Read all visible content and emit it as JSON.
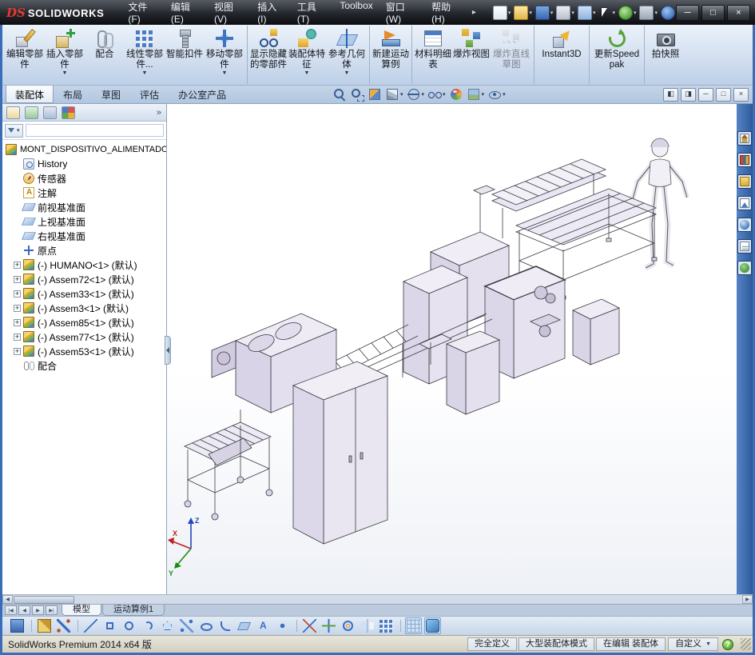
{
  "glyphs": {
    "down_arrow": "▼",
    "small_down": "▾",
    "plus": "+",
    "left_arrow": "◀",
    "right_arrow": "▶",
    "nav_first": "|◀",
    "nav_last": "▶|",
    "chevrons": "»",
    "minimize": "─",
    "maximize": "□",
    "close": "×",
    "pane_left": "◧",
    "pane_right": "◨",
    "menu_pin": "▸",
    "help": "?"
  },
  "titlebar": {
    "brand_mark": "DS",
    "brand_name": "SOLIDWORKS",
    "menus": [
      "文件(F)",
      "编辑(E)",
      "视图(V)",
      "插入(I)",
      "工具(T)",
      "Toolbox",
      "窗口(W)",
      "帮助(H)"
    ],
    "quick_icons": [
      {
        "name": "new-document-icon",
        "cls": "qi-new",
        "arrow": true
      },
      {
        "name": "open-icon",
        "cls": "qi-open",
        "arrow": true
      },
      {
        "name": "save-icon",
        "cls": "qi-save",
        "arrow": true
      },
      {
        "name": "print-icon",
        "cls": "qi-print",
        "arrow": true
      },
      {
        "name": "undo-icon",
        "cls": "qi-undo",
        "arrow": true
      },
      {
        "name": "select-icon",
        "cls": "qi-select",
        "arrow": true
      },
      {
        "name": "rebuild-icon",
        "cls": "qi-rebuild",
        "arrow": true
      },
      {
        "name": "options-icon",
        "cls": "qi-options",
        "arrow": true
      },
      {
        "name": "help-icon",
        "cls": "qi-help"
      }
    ]
  },
  "ribbon": {
    "buttons": [
      {
        "label": "编辑零部件",
        "icon": "ri-edit",
        "name": "edit-component-icon"
      },
      {
        "label": "插入零部件",
        "icon": "ri-insert",
        "name": "insert-components-icon",
        "arrow": true
      },
      {
        "label": "配合",
        "icon": "ri-mate",
        "name": "mate-icon"
      },
      {
        "label": "线性零部件...",
        "icon": "ri-pattern",
        "name": "linear-component-pattern-icon",
        "arrow": true
      },
      {
        "label": "智能扣件",
        "icon": "ri-fastener",
        "name": "smart-fasteners-icon"
      },
      {
        "label": "移动零部件",
        "icon": "ri-move",
        "name": "move-component-icon",
        "arrow": true
      },
      {
        "label": "显示隐藏的零部件",
        "icon": "ri-showhidden",
        "name": "show-hidden-components-icon",
        "mod": "grp"
      },
      {
        "label": "装配体特征",
        "icon": "ri-asmfeature",
        "name": "assembly-features-icon",
        "arrow": true
      },
      {
        "label": "参考几何体",
        "icon": "ri-refgeo",
        "name": "reference-geometry-icon",
        "arrow": true
      },
      {
        "label": "新建运动算例",
        "icon": "ri-motion",
        "name": "new-motion-study-icon",
        "mod": "grp"
      },
      {
        "label": "材料明细表",
        "icon": "ri-bom",
        "name": "bill-of-materials-icon",
        "mod": "grp"
      },
      {
        "label": "爆炸视图",
        "icon": "ri-explode",
        "name": "exploded-view-icon"
      },
      {
        "label": "爆炸直线草图",
        "icon": "ri-explodesketch",
        "name": "explode-line-sketch-icon",
        "mod": "disabled"
      },
      {
        "label": "Instant3D",
        "icon": "ri-instant3d",
        "name": "instant3d-icon",
        "mod": "grp wide"
      },
      {
        "label": "更新Speedpak",
        "icon": "ri-speedpak",
        "name": "update-speedpak-icon",
        "mod": "grp wide"
      },
      {
        "label": "拍快照",
        "icon": "ri-snapshot",
        "name": "take-snapshot-icon",
        "mod": "grp"
      }
    ]
  },
  "command_tabs": [
    {
      "label": "装配体",
      "state": "active"
    },
    {
      "label": "布局"
    },
    {
      "label": "草图"
    },
    {
      "label": "评估"
    },
    {
      "label": "办公室产品"
    }
  ],
  "view_toolbar": {
    "icons": [
      {
        "name": "zoom-to-fit-icon",
        "cls": "hi-zoomfit"
      },
      {
        "name": "zoom-to-area-icon",
        "cls": "hi-zoomarea"
      },
      {
        "name": "section-view-icon",
        "cls": "hi-section"
      },
      {
        "name": "view-orientation-icon",
        "cls": "hi-orient",
        "arrow": true
      },
      {
        "name": "display-style-icon",
        "cls": "hi-display",
        "arrow": true
      },
      {
        "name": "hide-show-items-icon",
        "cls": "hi-hideshow",
        "arrow": true
      },
      {
        "name": "edit-appearance-icon",
        "cls": "hi-appearance"
      },
      {
        "name": "apply-scene-icon",
        "cls": "hi-scene",
        "arrow": true
      },
      {
        "name": "view-settings-icon",
        "cls": "hi-viewsettings",
        "arrow": true
      }
    ]
  },
  "panel_tabs": [
    {
      "name": "featuremanager-tab-icon",
      "cls": "pt-feature"
    },
    {
      "name": "propertymanager-tab-icon",
      "cls": "pt-property"
    },
    {
      "name": "configurationmanager-tab-icon",
      "cls": "pt-config"
    },
    {
      "name": "displaymanager-tab-icon",
      "cls": "pt-display"
    }
  ],
  "feature_tree": {
    "root": "MONT_DISPOSITIVO_ALIMENTADOR",
    "items": [
      {
        "label": "History",
        "icon": "ti-history",
        "name": "history-folder-icon",
        "expcls": "noexp"
      },
      {
        "label": "传感器",
        "icon": "ti-sensor",
        "name": "sensors-icon",
        "expcls": "noexp"
      },
      {
        "label": "注解",
        "icon": "ti-note",
        "name": "annotations-icon",
        "expcls": "noexp"
      },
      {
        "label": "前视基准面",
        "icon": "ti-plane",
        "name": "front-plane-icon",
        "expcls": "noexp"
      },
      {
        "label": "上视基准面",
        "icon": "ti-plane",
        "name": "top-plane-icon",
        "expcls": "noexp"
      },
      {
        "label": "右视基准面",
        "icon": "ti-plane",
        "name": "right-plane-icon",
        "expcls": "noexp"
      },
      {
        "label": "原点",
        "icon": "ti-origin",
        "name": "origin-icon",
        "expcls": "noexp"
      },
      {
        "label": "(-) HUMANO<1> (默认)",
        "icon": "ti-asm",
        "name": "component-icon",
        "expand": true
      },
      {
        "label": "(-) Assem72<1> (默认)",
        "icon": "ti-asm",
        "name": "component-icon",
        "expand": true
      },
      {
        "label": "(-) Assem33<1> (默认)",
        "icon": "ti-asm",
        "name": "component-icon",
        "expand": true
      },
      {
        "label": "(-) Assem3<1> (默认)",
        "icon": "ti-asm",
        "name": "component-icon",
        "expand": true
      },
      {
        "label": "(-) Assem85<1> (默认)",
        "icon": "ti-asm",
        "name": "component-icon",
        "expand": true
      },
      {
        "label": "(-) Assem77<1> (默认)",
        "icon": "ti-asm",
        "name": "component-icon",
        "expand": true
      },
      {
        "label": "(-) Assem53<1> (默认)",
        "icon": "ti-asm",
        "name": "component-icon",
        "expand": true
      },
      {
        "label": "配合",
        "icon": "ti-mates",
        "name": "mates-folder-icon",
        "expcls": "noexp"
      }
    ]
  },
  "task_pane": {
    "icons": [
      {
        "name": "solidworks-resources-icon",
        "cls": "tp-resources"
      },
      {
        "name": "design-library-icon",
        "cls": "tp-library"
      },
      {
        "name": "file-explorer-icon",
        "cls": "tp-explorer"
      },
      {
        "name": "view-palette-icon",
        "cls": "tp-palette"
      },
      {
        "name": "appearances-scenes-icon",
        "cls": "tp-appearance"
      },
      {
        "name": "custom-properties-icon",
        "cls": "tp-props"
      },
      {
        "name": "solidworks-forum-icon",
        "cls": "tp-forum"
      }
    ]
  },
  "sheet_tabs": [
    {
      "label": "模型",
      "state": "active"
    },
    {
      "label": "运动算例1"
    }
  ],
  "sketch_toolbar": {
    "icons": [
      {
        "name": "save-icon",
        "cls": "bi-save"
      },
      {
        "name": "sketch-icon",
        "cls": "bi-sketch",
        "mod": "grp"
      },
      {
        "name": "smart-dimension-icon",
        "cls": "bi-dim"
      },
      {
        "name": "line-icon",
        "cls": "bi-line",
        "mod": "grp"
      },
      {
        "name": "rectangle-icon",
        "cls": "bi-rect"
      },
      {
        "name": "circle-icon",
        "cls": "bi-circle"
      },
      {
        "name": "arc-icon",
        "cls": "bi-arc"
      },
      {
        "name": "polygon-icon",
        "cls": "bi-poly"
      },
      {
        "name": "spline-icon",
        "cls": "bi-spline"
      },
      {
        "name": "ellipse-icon",
        "cls": "bi-ellipse"
      },
      {
        "name": "fillet-icon",
        "cls": "bi-fillet"
      },
      {
        "name": "plane-icon",
        "cls": "bi-plane"
      },
      {
        "name": "text-icon",
        "cls": "bi-text"
      },
      {
        "name": "point-icon",
        "cls": "bi-point"
      },
      {
        "name": "trim-entities-icon",
        "cls": "bi-trim",
        "mod": "grp"
      },
      {
        "name": "convert-entities-icon",
        "cls": "bi-convert"
      },
      {
        "name": "offset-entities-icon",
        "cls": "bi-offset"
      },
      {
        "name": "mirror-entities-icon",
        "cls": "bi-mirror"
      },
      {
        "name": "linear-sketch-pattern-icon",
        "cls": "bi-pattern"
      },
      {
        "name": "display-grid-icon",
        "cls": "bi-grid",
        "mod": "grp pressed"
      },
      {
        "name": "shaded-sketch-contours-icon",
        "cls": "bi-shaded",
        "mod": "pressed"
      }
    ]
  },
  "statusbar": {
    "product": "SolidWorks Premium 2014 x64 版",
    "cells": [
      "完全定义",
      "大型装配体模式",
      "在编辑 装配体"
    ],
    "custom_label": "自定义",
    "help_glyph": "?"
  },
  "triad": {
    "x": "X",
    "y": "Y",
    "z": "Z"
  }
}
